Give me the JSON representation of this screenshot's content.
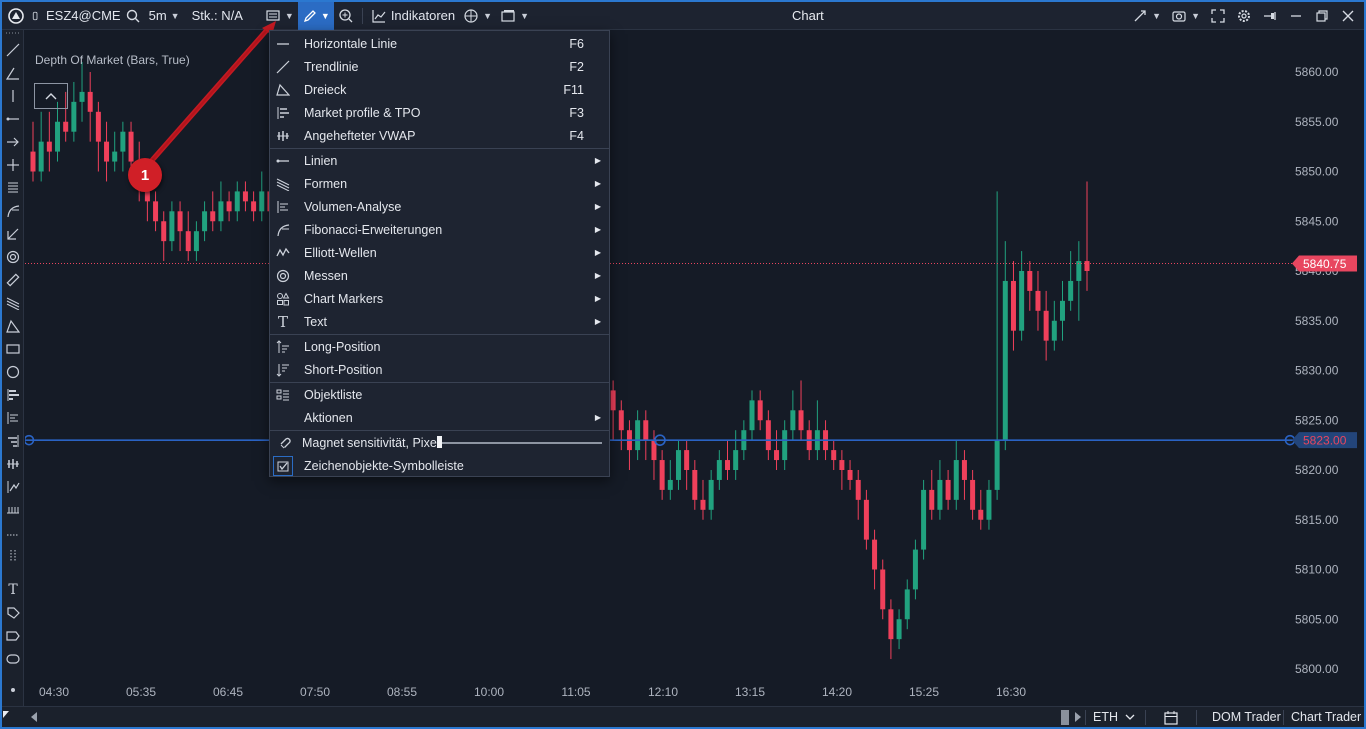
{
  "toolbar": {
    "symbol": "ESZ4@CME",
    "timeframe": "5m",
    "quantity": "Stk.: N/A",
    "indicators_label": "Indikatoren",
    "chart_title": "Chart"
  },
  "chart": {
    "dom_label": "Depth Of Market (Bars, True)",
    "price_ticks": [
      "5860.00",
      "5855.00",
      "5850.00",
      "5845.00",
      "5840.00",
      "5835.00",
      "5830.00",
      "5825.00",
      "5820.00",
      "5815.00",
      "5810.00",
      "5805.00",
      "5800.00"
    ],
    "time_ticks": [
      "04:30",
      "05:35",
      "06:45",
      "07:50",
      "08:55",
      "10:00",
      "11:05",
      "12:10",
      "13:15",
      "14:20",
      "15:25",
      "16:30"
    ],
    "last_price": "5840.75",
    "line_price": "5823.00",
    "colors": {
      "up": "#21a27f",
      "down": "#f0405b",
      "line": "#2a63c4",
      "background": "#151b26"
    }
  },
  "chart_data": {
    "type": "candlestick",
    "ylim": [
      5798,
      5863
    ],
    "last_price": 5840.75,
    "horizontal_line": 5823.0,
    "candles": [
      [
        5852,
        5850,
        5855,
        5849
      ],
      [
        5850,
        5853,
        5856,
        5849
      ],
      [
        5853,
        5852,
        5856,
        5850
      ],
      [
        5852,
        5855,
        5857,
        5851
      ],
      [
        5855,
        5854,
        5858,
        5853
      ],
      [
        5854,
        5857,
        5859,
        5853
      ],
      [
        5857,
        5858,
        5861,
        5855
      ],
      [
        5858,
        5856,
        5860,
        5853
      ],
      [
        5856,
        5853,
        5857,
        5850
      ],
      [
        5853,
        5851,
        5855,
        5849
      ],
      [
        5851,
        5852,
        5854,
        5850
      ],
      [
        5852,
        5854,
        5855,
        5850
      ],
      [
        5854,
        5851,
        5855,
        5849
      ],
      [
        5851,
        5849,
        5853,
        5847
      ],
      [
        5849,
        5847,
        5850,
        5845
      ],
      [
        5847,
        5845,
        5848,
        5844
      ],
      [
        5845,
        5843,
        5846,
        5841
      ],
      [
        5843,
        5846,
        5847,
        5842
      ],
      [
        5846,
        5844,
        5847,
        5842
      ],
      [
        5844,
        5842,
        5846,
        5841
      ],
      [
        5842,
        5844,
        5845,
        5841
      ],
      [
        5844,
        5846,
        5847,
        5843
      ],
      [
        5846,
        5845,
        5848,
        5844
      ],
      [
        5845,
        5847,
        5849,
        5844
      ],
      [
        5847,
        5846,
        5848,
        5845
      ],
      [
        5846,
        5848,
        5849,
        5845
      ],
      [
        5848,
        5847,
        5849,
        5846
      ],
      [
        5847,
        5846,
        5848,
        5845
      ],
      [
        5846,
        5848,
        5850,
        5845
      ],
      [
        5848,
        5846,
        5849,
        5844
      ],
      [
        5846,
        5843,
        5847,
        5842
      ],
      [
        5843,
        5840,
        5844,
        5839
      ],
      [
        5840,
        5838,
        5842,
        5837
      ],
      [
        5838,
        5840,
        5841,
        5837
      ],
      [
        5840,
        5843,
        5844,
        5839
      ],
      [
        5843,
        5846,
        5847,
        5842
      ],
      [
        5846,
        5845,
        5848,
        5844
      ],
      [
        5845,
        5847,
        5849,
        5844
      ],
      [
        5847,
        5846,
        5848,
        5845
      ],
      [
        5846,
        5848,
        5850,
        5845
      ],
      [
        5848,
        5846,
        5849,
        5845
      ],
      [
        5846,
        5844,
        5847,
        5843
      ],
      [
        5844,
        5846,
        5847,
        5843
      ],
      [
        5846,
        5845,
        5848,
        5844
      ],
      [
        5845,
        5843,
        5846,
        5841
      ],
      [
        5843,
        5841,
        5844,
        5839
      ],
      [
        5841,
        5838,
        5842,
        5836
      ],
      [
        5838,
        5835,
        5839,
        5833
      ],
      [
        5835,
        5832,
        5836,
        5830
      ],
      [
        5832,
        5829,
        5833,
        5828
      ],
      [
        5829,
        5831,
        5832,
        5827
      ],
      [
        5831,
        5828,
        5832,
        5826
      ],
      [
        5828,
        5826,
        5829,
        5824
      ],
      [
        5826,
        5823,
        5827,
        5822
      ],
      [
        5823,
        5825,
        5826,
        5821
      ],
      [
        5825,
        5827,
        5828,
        5823
      ],
      [
        5827,
        5829,
        5830,
        5825
      ],
      [
        5829,
        5833,
        5834,
        5828
      ],
      [
        5833,
        5836,
        5838,
        5832
      ],
      [
        5836,
        5839,
        5841,
        5835
      ],
      [
        5839,
        5838,
        5841,
        5836
      ],
      [
        5838,
        5833,
        5839,
        5831
      ],
      [
        5833,
        5829,
        5834,
        5827
      ],
      [
        5829,
        5834,
        5835,
        5828
      ],
      [
        5834,
        5836,
        5839,
        5833
      ],
      [
        5836,
        5838,
        5840,
        5835
      ],
      [
        5838,
        5832,
        5839,
        5830
      ],
      [
        5832,
        5829,
        5833,
        5828
      ],
      [
        5829,
        5826,
        5830,
        5824
      ],
      [
        5826,
        5825,
        5827,
        5823
      ],
      [
        5825,
        5828,
        5829,
        5824
      ],
      [
        5828,
        5826,
        5829,
        5823
      ],
      [
        5826,
        5824,
        5827,
        5822
      ],
      [
        5824,
        5822,
        5825,
        5820
      ],
      [
        5822,
        5825,
        5826,
        5821
      ],
      [
        5825,
        5823,
        5826,
        5821
      ],
      [
        5823,
        5821,
        5824,
        5819
      ],
      [
        5821,
        5818,
        5822,
        5817
      ],
      [
        5818,
        5819,
        5821,
        5817
      ],
      [
        5819,
        5822,
        5823,
        5818
      ],
      [
        5822,
        5820,
        5823,
        5818
      ],
      [
        5820,
        5817,
        5821,
        5816
      ],
      [
        5817,
        5816,
        5819,
        5815
      ],
      [
        5816,
        5819,
        5820,
        5815
      ],
      [
        5819,
        5821,
        5822,
        5818
      ],
      [
        5821,
        5820,
        5823,
        5819
      ],
      [
        5820,
        5822,
        5824,
        5819
      ],
      [
        5822,
        5824,
        5825,
        5821
      ],
      [
        5824,
        5827,
        5828,
        5823
      ],
      [
        5827,
        5825,
        5828,
        5824
      ],
      [
        5825,
        5822,
        5826,
        5821
      ],
      [
        5822,
        5821,
        5824,
        5820
      ],
      [
        5821,
        5824,
        5825,
        5820
      ],
      [
        5824,
        5826,
        5828,
        5823
      ],
      [
        5826,
        5824,
        5829,
        5823
      ],
      [
        5824,
        5822,
        5825,
        5821
      ],
      [
        5822,
        5824,
        5827,
        5821
      ],
      [
        5824,
        5822,
        5825,
        5821
      ],
      [
        5822,
        5821,
        5823,
        5820
      ],
      [
        5821,
        5820,
        5822,
        5818
      ],
      [
        5820,
        5819,
        5821,
        5818
      ],
      [
        5819,
        5817,
        5820,
        5815
      ],
      [
        5817,
        5813,
        5818,
        5812
      ],
      [
        5813,
        5810,
        5814,
        5808
      ],
      [
        5810,
        5806,
        5811,
        5805
      ],
      [
        5806,
        5803,
        5807,
        5801
      ],
      [
        5803,
        5805,
        5806,
        5802
      ],
      [
        5805,
        5808,
        5809,
        5804
      ],
      [
        5808,
        5812,
        5813,
        5807
      ],
      [
        5812,
        5818,
        5819,
        5811
      ],
      [
        5818,
        5816,
        5820,
        5815
      ],
      [
        5816,
        5819,
        5821,
        5815
      ],
      [
        5819,
        5817,
        5820,
        5816
      ],
      [
        5817,
        5821,
        5823,
        5816
      ],
      [
        5821,
        5819,
        5822,
        5817
      ],
      [
        5819,
        5816,
        5820,
        5815
      ],
      [
        5816,
        5815,
        5818,
        5814
      ],
      [
        5815,
        5818,
        5819,
        5814
      ],
      [
        5818,
        5823,
        5848,
        5817
      ],
      [
        5823,
        5839,
        5843,
        5822
      ],
      [
        5839,
        5834,
        5841,
        5832
      ],
      [
        5834,
        5840,
        5842,
        5833
      ],
      [
        5840,
        5838,
        5841,
        5836
      ],
      [
        5838,
        5836,
        5840,
        5834
      ],
      [
        5836,
        5833,
        5838,
        5831
      ],
      [
        5833,
        5835,
        5837,
        5832
      ],
      [
        5835,
        5837,
        5839,
        5833
      ],
      [
        5837,
        5839,
        5842,
        5836
      ],
      [
        5839,
        5841,
        5843,
        5835
      ],
      [
        5841,
        5840,
        5849,
        5838
      ]
    ]
  },
  "draw_menu": {
    "items": [
      {
        "label": "Horizontale Linie",
        "key": "F6"
      },
      {
        "label": "Trendlinie",
        "key": "F2"
      },
      {
        "label": "Dreieck",
        "key": "F11"
      },
      {
        "label": "Market profile & TPO",
        "key": "F3"
      },
      {
        "label": "Angehefteter VWAP",
        "key": "F4"
      },
      {
        "label": "Linien"
      },
      {
        "label": "Formen"
      },
      {
        "label": "Volumen-Analyse"
      },
      {
        "label": "Fibonacci-Erweiterungen"
      },
      {
        "label": "Elliott-Wellen"
      },
      {
        "label": "Messen"
      },
      {
        "label": "Chart Markers"
      },
      {
        "label": "Text"
      },
      {
        "label": "Long-Position"
      },
      {
        "label": "Short-Position"
      },
      {
        "label": "Objektliste"
      },
      {
        "label": "Aktionen"
      },
      {
        "label": "Magnet sensitivität, Pixel"
      },
      {
        "label": "Zeichenobjekte-Symbolleiste"
      }
    ]
  },
  "annotation": {
    "number": "1"
  },
  "bottom": {
    "session": "ETH",
    "dom_trader": "DOM Trader",
    "chart_trader": "Chart Trader"
  }
}
